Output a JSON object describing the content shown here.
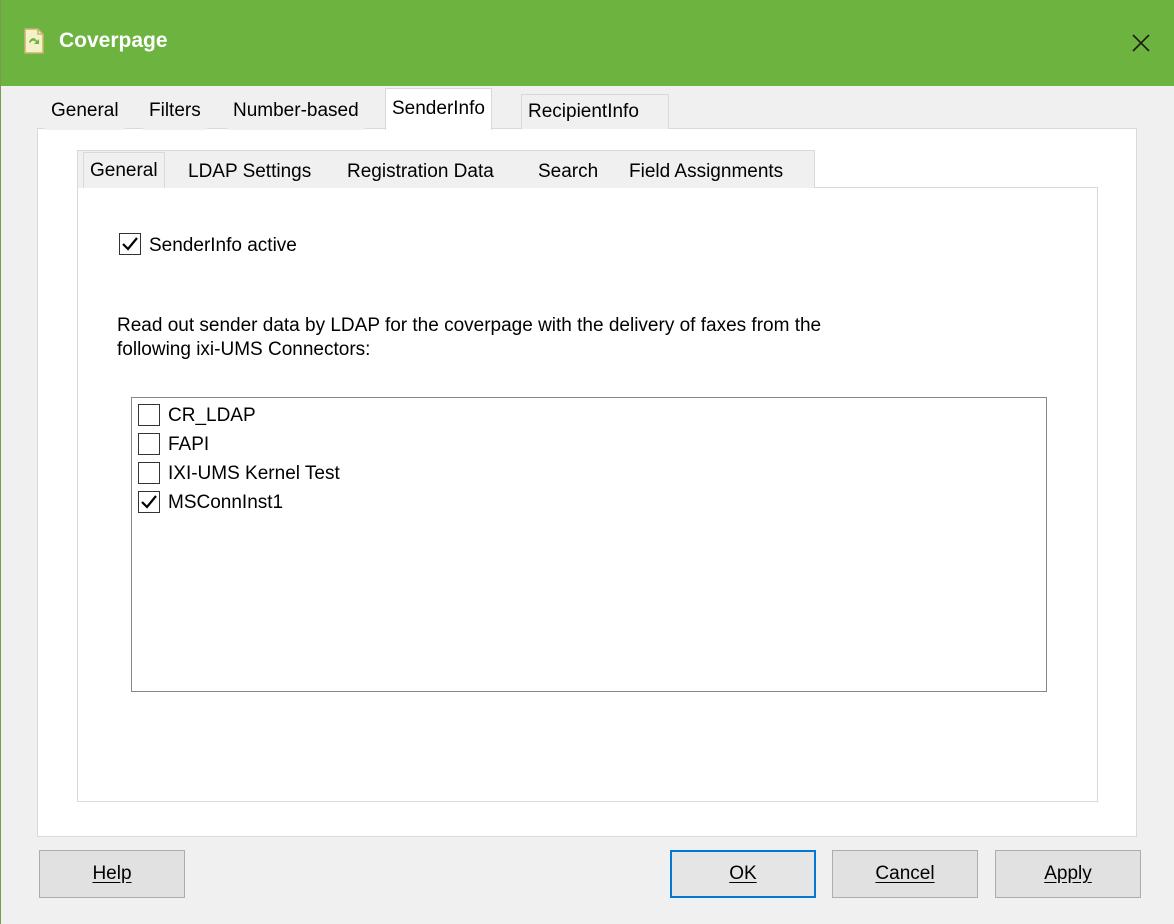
{
  "window": {
    "title": "Coverpage",
    "title_bar_color": "#6db33f",
    "close_icon": "close-icon"
  },
  "outer_tabs": [
    {
      "label": "General",
      "selected": false
    },
    {
      "label": "Filters",
      "selected": false
    },
    {
      "label": "Number-based",
      "selected": false
    },
    {
      "label": "SenderInfo",
      "selected": true
    },
    {
      "label": "RecipientInfo",
      "selected": false
    }
  ],
  "inner_tabs": [
    {
      "label": "General",
      "selected": true
    },
    {
      "label": "LDAP Settings",
      "selected": false
    },
    {
      "label": "Registration Data",
      "selected": false
    },
    {
      "label": "Search",
      "selected": false
    },
    {
      "label": "Field Assignments",
      "selected": false
    }
  ],
  "senderinfo": {
    "active_label": "SenderInfo active",
    "active_checked": true,
    "description_line1": "Read out sender data by LDAP for the coverpage with the delivery of faxes from the",
    "description_line2": "following ixi-UMS Connectors:"
  },
  "connectors": [
    {
      "label": "CR_LDAP",
      "checked": false
    },
    {
      "label": "FAPI",
      "checked": false
    },
    {
      "label": "IXI-UMS Kernel Test",
      "checked": false
    },
    {
      "label": "MSConnInst1",
      "checked": true
    }
  ],
  "buttons": {
    "help": "Help",
    "ok": "OK",
    "cancel": "Cancel",
    "apply": "Apply"
  }
}
